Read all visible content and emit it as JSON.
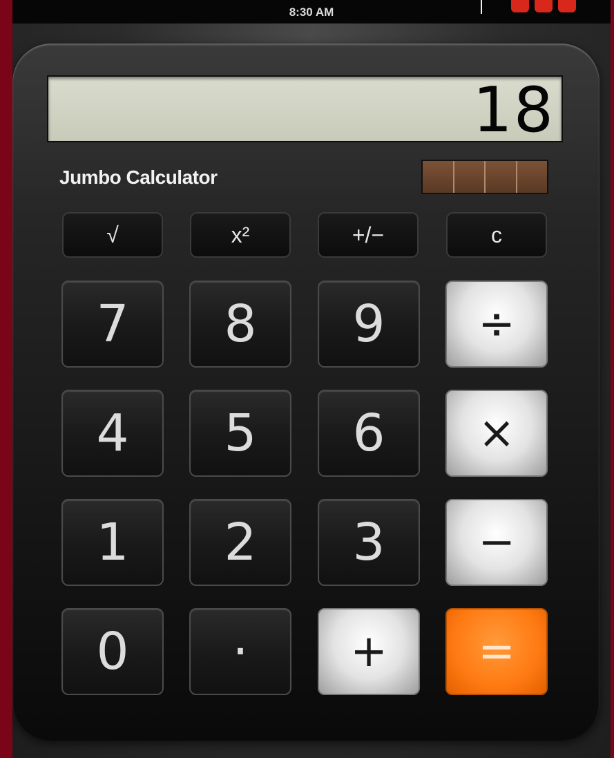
{
  "status_bar": {
    "time": "8:30 AM"
  },
  "app": {
    "brand": "Jumbo Calculator"
  },
  "display": {
    "value": "18"
  },
  "keys": {
    "sqrt": "√",
    "square": "x²",
    "negate": "+/−",
    "clear": "c",
    "seven": "7",
    "eight": "8",
    "nine": "9",
    "divide": "÷",
    "four": "4",
    "five": "5",
    "six": "6",
    "multiply": "×",
    "one": "1",
    "two": "2",
    "three": "3",
    "subtract": "−",
    "zero": "0",
    "decimal": "·",
    "add": "+",
    "equals": "="
  },
  "colors": {
    "background": "#7a0418",
    "display_bg": "#d9dccd",
    "equals_key": "#ff7a12",
    "operator_key": "#e3e3e3"
  }
}
